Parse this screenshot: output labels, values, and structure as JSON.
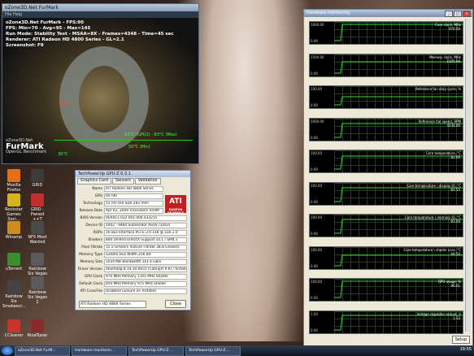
{
  "furmark": {
    "window_title": "oZone3D.Net FurMark",
    "menu": "File  Help",
    "lines": [
      "oZone3D.Net FurMark - FPS:90",
      "FPS: Min=70 - Avg=95 - Max=145",
      "Run Mode: Stability Test - MSAA=8X - Frames=4348 - Time=45 sec",
      "Renderer: ATI Radeon HD 4800 Series - GL=2.1",
      "Screenshot: F9"
    ],
    "logo_small": "oZone3D.Net",
    "logo_big": "FurMark",
    "logo_sub": "OpenGL Benchmark",
    "temp_label_red": "100°C",
    "temp_label_green": "83°C (GPU1) - 83°C (Max)",
    "temp_label_mid": "50°C (Min)",
    "temp_label_low": "30°C"
  },
  "gpuz": {
    "window_title": "TechPowerUp GPU-Z 0.3.1",
    "tabs": [
      "Graphics Card",
      "Sensors",
      "Validation"
    ],
    "rows": [
      {
        "label": "Name",
        "value": "ATI Radeon HD 4800 Series"
      },
      {
        "label": "GPU",
        "value": "RV790"
      },
      {
        "label": "Technology",
        "value": "55 nm     Die Size  282 mm²"
      },
      {
        "label": "Release Date",
        "value": "Apr 02, 2009   Transistors  959M"
      },
      {
        "label": "BIOS Version",
        "value": "VER011.022.001.000.033215"
      },
      {
        "label": "Device ID",
        "value": "1002 - 9460   Subvendor  ASUS (1043)"
      },
      {
        "label": "ROPs",
        "value": "16   Bus Interface  PCI-E 2.0 x16 @ x16 2.0"
      },
      {
        "label": "Shaders",
        "value": "800 Unified   DirectX Support  10.1 / SM4.1"
      },
      {
        "label": "Pixel Fillrate",
        "value": "15.5 GPixel/s  Texture Fillrate  38.8 GTexel/s"
      },
      {
        "label": "Memory Type",
        "value": "GDDR5     Bus Width  256 Bit"
      },
      {
        "label": "Memory Size",
        "value": "1024 MB   Bandwidth  141.4 GB/s"
      },
      {
        "label": "Driver Version",
        "value": "atiumdag 8.14.10.0655 (Catalyst 9.6) / Vista64"
      },
      {
        "label": "GPU Clock",
        "value": "970 MHz   Memory  1105 MHz   Shader"
      },
      {
        "label": "Default Clock",
        "value": "850 MHz   Memory  975 MHz   Shader"
      },
      {
        "label": "ATI CrossFire",
        "value": "Disabled (unsure on Vista64)"
      }
    ],
    "ati_logo": "ATI",
    "ati_sub": "RADEON GRAPHICS",
    "select_value": "ATI Radeon HD 4800 Series",
    "close_label": "Close"
  },
  "hw_monitor": {
    "window_title": "Hardware monitoring",
    "setup_label": "Setup",
    "panels": [
      {
        "title": "Core clock, MHz",
        "ymax": "1000.00",
        "ymin": "0.00",
        "current": "970.00",
        "level": 0.97
      },
      {
        "title": "Memory clock, MHz",
        "ymax": "1500.00",
        "ymin": "0.00",
        "current": "1105.00",
        "level": 0.74
      },
      {
        "title": "Reference fan duty cycle, %",
        "ymax": "100.00",
        "ymin": "0.00",
        "current": "",
        "level": 0.55
      },
      {
        "title": "Reference fan speed, RPM",
        "ymax": "5000.00",
        "ymin": "0.00",
        "current": "4236.00",
        "level": 0.85
      },
      {
        "title": "Core temperature, °C",
        "ymax": "100.00",
        "ymin": "0.00",
        "current": "82.00",
        "level": 0.82
      },
      {
        "title": "Core temperature \\ display IO, °C",
        "ymax": "100.00",
        "ymin": "0.00",
        "current": "82.55",
        "level": 0.83
      },
      {
        "title": "Core temperature \\ memory IO, °C",
        "ymax": "100.00",
        "ymin": "0.00",
        "current": "83.00",
        "level": 0.83
      },
      {
        "title": "Core temperature \\ shader core, °C",
        "ymax": "100.00",
        "ymin": "0.00",
        "current": "69.50",
        "level": 0.7
      },
      {
        "title": "GPU usage, %",
        "ymax": "100.00",
        "ymin": "0.00",
        "current": "96.61",
        "level": 0.97
      },
      {
        "title": "Voltage regulator output, V",
        "ymax": "1.50",
        "ymin": "0.00",
        "current": "1.33",
        "level": 0.89
      }
    ]
  },
  "desktop_icons": [
    {
      "label": "Mozilla Firefox",
      "color": "#e76f1a"
    },
    {
      "label": "GRID",
      "color": "#3b3b3b"
    },
    {
      "label": "Rockstar Games Soci...",
      "color": "#d7b21f"
    },
    {
      "label": "GRID - Pwned ++T",
      "color": "#c62d2d"
    },
    {
      "label": "Winamp",
      "color": "#cf8c1a"
    },
    {
      "label": "NFS Most Wanted",
      "color": "#4a4a4a"
    },
    {
      "label": "uTorrent",
      "color": "#3c8e2c"
    },
    {
      "label": "Rainbow Six Vegas 2",
      "color": "#5b5b5b"
    },
    {
      "label": "Rainbow Six Vegas 2",
      "color": "#5b5b5b"
    },
    {
      "label": "Rainbow Six Smokescr...",
      "color": "#444444"
    },
    {
      "label": "CCleaner",
      "color": "#c8332a"
    },
    {
      "label": "RivaTuner",
      "color": "#8b2a2a"
    }
  ],
  "taskbar": {
    "items": [
      "oZone3D.Net FurM...",
      "Hardware monitorin...",
      "TechPowerUp GPU-Z ...",
      "TechPowerUp GPU-Z..."
    ],
    "clock": "19:55"
  }
}
